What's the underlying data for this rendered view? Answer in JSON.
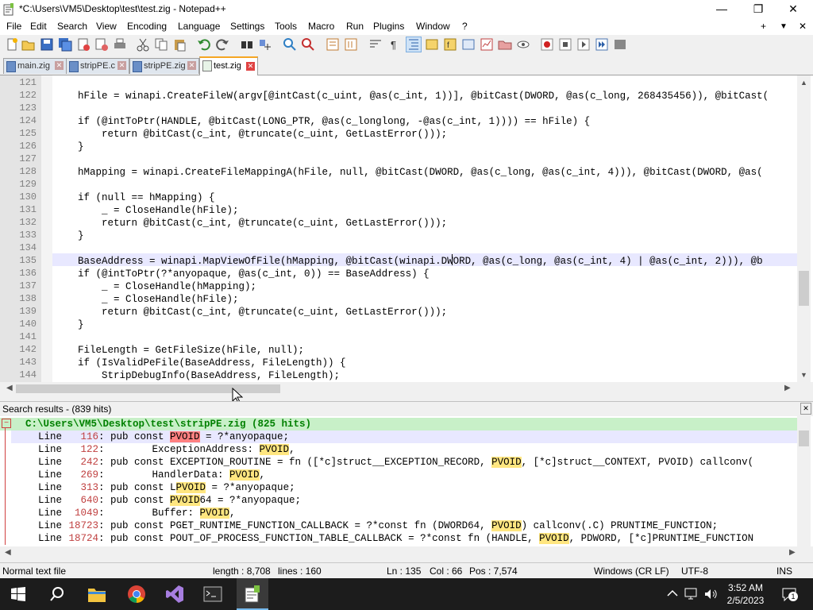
{
  "window": {
    "title": "*C:\\Users\\VM5\\Desktop\\test\\test.zig - Notepad++",
    "controls": {
      "minimize": "—",
      "maximize": "❐",
      "close": "✕"
    }
  },
  "menu": [
    "File",
    "Edit",
    "Search",
    "View",
    "Encoding",
    "Language",
    "Settings",
    "Tools",
    "Macro",
    "Run",
    "Plugins",
    "Window",
    "?"
  ],
  "menu_right": {
    "plus": "+",
    "down": "▼",
    "close": "✕"
  },
  "tabs": [
    {
      "label": "main.zig",
      "close": "✕"
    },
    {
      "label": "stripPE.c",
      "close": "✕"
    },
    {
      "label": "stripPE.zig",
      "close": "✕"
    },
    {
      "label": "test.zig",
      "close": "✕"
    }
  ],
  "editor": {
    "lines": [
      {
        "n": "121",
        "t": ""
      },
      {
        "n": "122",
        "t": "    hFile = winapi.CreateFileW(argv[@intCast(c_uint, @as(c_int, 1))], @bitCast(DWORD, @as(c_long, 268435456)), @bitCast("
      },
      {
        "n": "123",
        "t": ""
      },
      {
        "n": "124",
        "t": "    if (@intToPtr(HANDLE, @bitCast(LONG_PTR, @as(c_longlong, -@as(c_int, 1)))) == hFile) {"
      },
      {
        "n": "125",
        "t": "        return @bitCast(c_int, @truncate(c_uint, GetLastError()));"
      },
      {
        "n": "126",
        "t": "    }"
      },
      {
        "n": "127",
        "t": ""
      },
      {
        "n": "128",
        "t": "    hMapping = winapi.CreateFileMappingA(hFile, null, @bitCast(DWORD, @as(c_long, @as(c_int, 4))), @bitCast(DWORD, @as("
      },
      {
        "n": "129",
        "t": ""
      },
      {
        "n": "130",
        "t": "    if (null == hMapping) {"
      },
      {
        "n": "131",
        "t": "        _ = CloseHandle(hFile);"
      },
      {
        "n": "132",
        "t": "        return @bitCast(c_int, @truncate(c_uint, GetLastError()));"
      },
      {
        "n": "133",
        "t": "    }"
      },
      {
        "n": "134",
        "t": ""
      },
      {
        "n": "135",
        "t": "    BaseAddress = winapi.MapViewOfFile(hMapping, @bitCast(winapi.DWORD, @as(c_long, @as(c_int, 4) | @as(c_int, 2))), @b"
      },
      {
        "n": "136",
        "t": "    if (@intToPtr(?*anyopaque, @as(c_int, 0)) == BaseAddress) {"
      },
      {
        "n": "137",
        "t": "        _ = CloseHandle(hMapping);"
      },
      {
        "n": "138",
        "t": "        _ = CloseHandle(hFile);"
      },
      {
        "n": "139",
        "t": "        return @bitCast(c_int, @truncate(c_uint, GetLastError()));"
      },
      {
        "n": "140",
        "t": "    }"
      },
      {
        "n": "141",
        "t": ""
      },
      {
        "n": "142",
        "t": "    FileLength = GetFileSize(hFile, null);"
      },
      {
        "n": "143",
        "t": "    if (IsValidPeFile(BaseAddress, FileLength)) {"
      },
      {
        "n": "144",
        "t": "        StripDebugInfo(BaseAddress, FileLength);"
      }
    ]
  },
  "search": {
    "header": "Search results - (839 hits)",
    "close": "✕",
    "file_header": "C:\\Users\\VM5\\Desktop\\test\\stripPE.zig (825 hits)",
    "fold": "−",
    "results": [
      {
        "label": "Line",
        "num": "116",
        "pre": ": pub const ",
        "hit": "PVOID",
        "post": " = ?*anyopaque;"
      },
      {
        "label": "Line",
        "num": "122",
        "pre": ":        ExceptionAddress: ",
        "hit": "PVOID",
        "post": ","
      },
      {
        "label": "Line",
        "num": "242",
        "pre": ": pub const EXCEPTION_ROUTINE = fn ([*c]struct__EXCEPTION_RECORD, ",
        "hit": "PVOID",
        "post": ", [*c]struct__CONTEXT, PVOID) callconv("
      },
      {
        "label": "Line",
        "num": "269",
        "pre": ":        HandlerData: ",
        "hit": "PVOID",
        "post": ","
      },
      {
        "label": "Line",
        "num": "313",
        "pre": ": pub const L",
        "hit": "PVOID",
        "post": " = ?*anyopaque;"
      },
      {
        "label": "Line",
        "num": "640",
        "pre": ": pub const ",
        "hit": "PVOID",
        "post": "64 = ?*anyopaque;"
      },
      {
        "label": "Line",
        "num": "1049",
        "pre": ":        Buffer: ",
        "hit": "PVOID",
        "post": ","
      },
      {
        "label": "Line",
        "num": "18723",
        "pre": ": pub const PGET_RUNTIME_FUNCTION_CALLBACK = ?*const fn (DWORD64, ",
        "hit": "PVOID",
        "post": ") callconv(.C) PRUNTIME_FUNCTION;"
      },
      {
        "label": "Line",
        "num": "18724",
        "pre": ": pub const POUT_OF_PROCESS_FUNCTION_TABLE_CALLBACK = ?*const fn (HANDLE, ",
        "hit": "PVOID",
        "post": ", PDWORD, [*c]PRUNTIME_FUNCTION"
      }
    ]
  },
  "status": {
    "type": "Normal text file",
    "length": "length : 8,708",
    "lines": "lines : 160",
    "ln": "Ln : 135",
    "col": "Col : 66",
    "pos": "Pos : 7,574",
    "eol": "Windows (CR LF)",
    "enc": "UTF-8",
    "ins": "INS"
  },
  "taskbar": {
    "time": "3:52 AM",
    "date": "2/5/2023",
    "notif_count": "1"
  },
  "colors": {
    "linenum": "#808080",
    "hit_bg": "#ffe680",
    "file_header_bg": "#c8f0c8",
    "taskbar": "#1c1c1c"
  }
}
